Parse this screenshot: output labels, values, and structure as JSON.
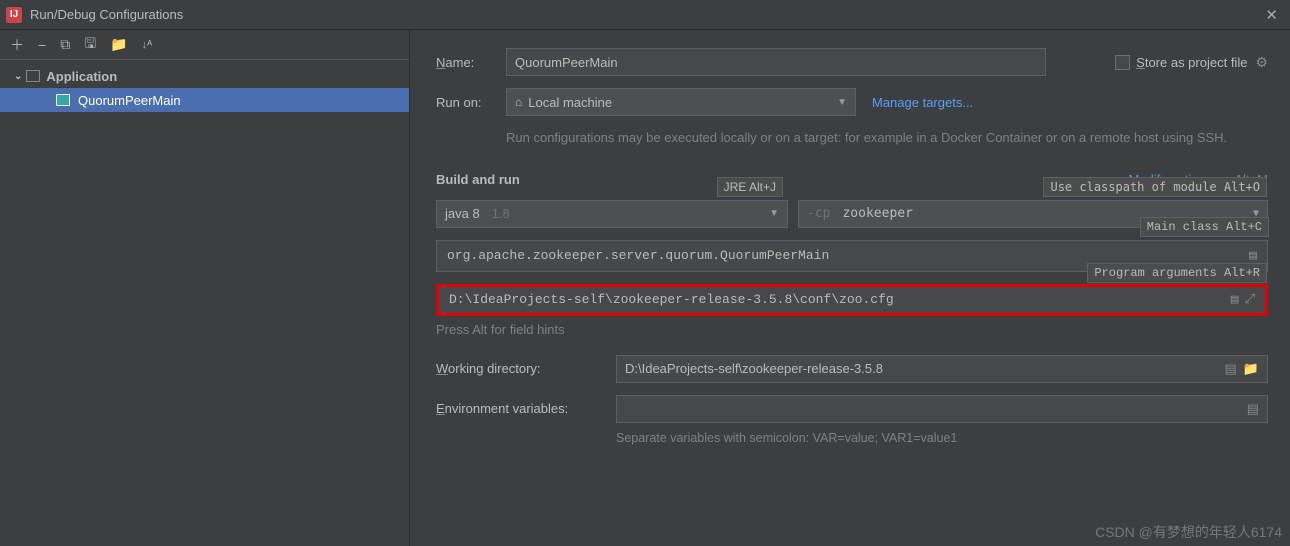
{
  "titlebar": {
    "title": "Run/Debug Configurations"
  },
  "sidebar": {
    "group": "Application",
    "selected": "QuorumPeerMain"
  },
  "form": {
    "name_label": "Name:",
    "name_value": "QuorumPeerMain",
    "store_label": "Store as project file",
    "runon_label": "Run on:",
    "runon_value": "Local machine",
    "manage_targets": "Manage targets...",
    "runon_help": "Run configurations may be executed locally or on a target: for example in a Docker Container or on a remote host using SSH.",
    "buildrun_label": "Build and run",
    "modify_options": "Modify options",
    "modify_shortcut": "Alt+M",
    "jre_name": "java 8",
    "jre_version": "1.8",
    "jre_tooltip": "JRE Alt+J",
    "cp_prefix": "-cp",
    "cp_value": "zookeeper",
    "cp_tooltip": "Use classpath of module Alt+O",
    "main_class": "org.apache.zookeeper.server.quorum.QuorumPeerMain",
    "main_class_tooltip": "Main class Alt+C",
    "program_args": "D:\\IdeaProjects-self\\zookeeper-release-3.5.8\\conf\\zoo.cfg",
    "program_args_tooltip": "Program arguments Alt+R",
    "field_hint": "Press Alt for field hints",
    "workdir_label": "Working directory:",
    "workdir_value": "D:\\IdeaProjects-self\\zookeeper-release-3.5.8",
    "env_label": "Environment variables:",
    "env_value": "",
    "env_hint": "Separate variables with semicolon: VAR=value; VAR1=value1"
  },
  "watermark": "CSDN @有梦想的年轻人6174"
}
